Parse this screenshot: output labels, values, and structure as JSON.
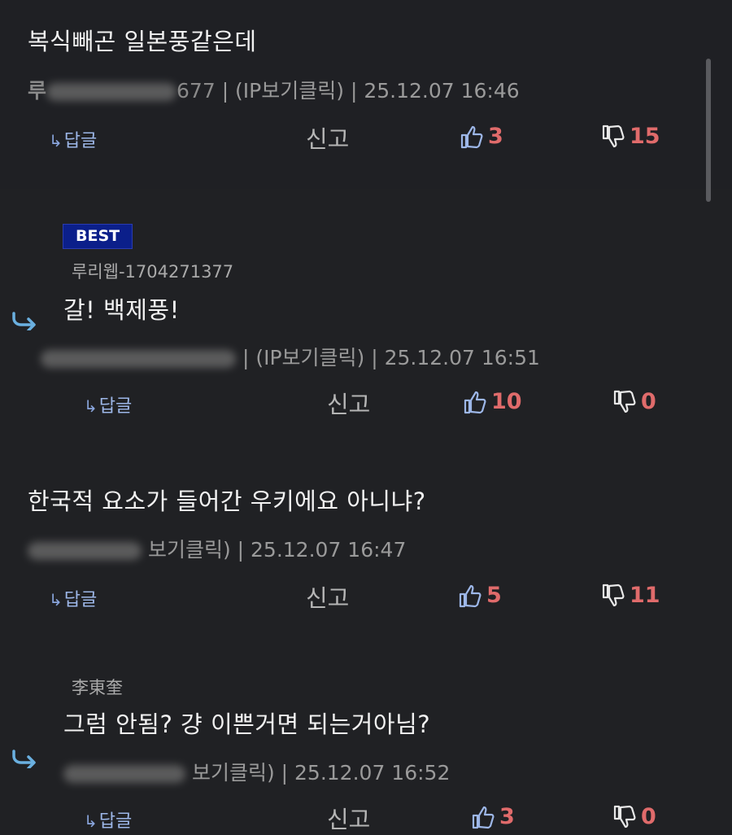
{
  "labels": {
    "reply": "답글",
    "report": "신고",
    "best": "BEST"
  },
  "comments": [
    {
      "text": "복식빼곤 일본풍같은데",
      "meta_visible": "| (IP보기클릭) | 25.12.07 16:46",
      "meta_fragment_left": "루",
      "meta_fragment_right": "677",
      "likes": "3",
      "dislikes": "15"
    },
    {
      "badge": "BEST",
      "author": "루리웹-1704271377",
      "text": "갈! 백제풍!",
      "meta_visible": "| (IP보기클릭) | 25.12.07 16:51",
      "likes": "10",
      "dislikes": "0"
    },
    {
      "text": "한국적 요소가 들어간 우키에요 아니냐?",
      "meta_visible": "보기클릭) | 25.12.07 16:47",
      "likes": "5",
      "dislikes": "11"
    },
    {
      "author": "李東奎",
      "text": "그럼 안됨? 걍 이쁜거면 되는거아님?",
      "meta_visible": "보기클릭) | 25.12.07 16:52",
      "likes": "3",
      "dislikes": "0"
    }
  ],
  "colors": {
    "background": "#202124",
    "vote_count": "#e06b6b",
    "thumb_icon": "#9db7e8",
    "best_badge": "#0b1f8a",
    "reply_arrow": "#6ab0e0"
  }
}
